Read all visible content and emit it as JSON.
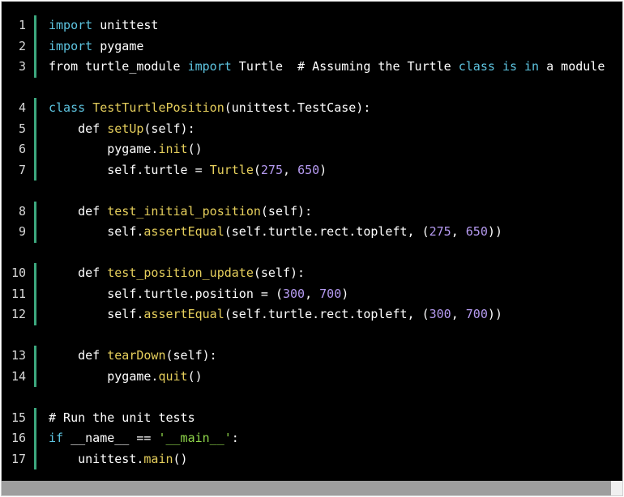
{
  "code": {
    "lines": [
      {
        "num": "1",
        "tokens": [
          {
            "t": "import",
            "c": "kw"
          },
          {
            "t": " unittest",
            "c": ""
          }
        ]
      },
      {
        "num": "2",
        "tokens": [
          {
            "t": "import",
            "c": "kw"
          },
          {
            "t": " pygame",
            "c": ""
          }
        ]
      },
      {
        "num": "3",
        "tokens": [
          {
            "t": "from turtle_module ",
            "c": ""
          },
          {
            "t": "import",
            "c": "kw"
          },
          {
            "t": " Turtle  # Assuming the Turtle ",
            "c": ""
          },
          {
            "t": "class",
            "c": "kw"
          },
          {
            "t": " ",
            "c": ""
          },
          {
            "t": "is",
            "c": "kw"
          },
          {
            "t": " ",
            "c": ""
          },
          {
            "t": "in",
            "c": "kw"
          },
          {
            "t": " a module",
            "c": ""
          }
        ]
      },
      {
        "num": "4",
        "tokens": [
          {
            "t": "class",
            "c": "kw"
          },
          {
            "t": " ",
            "c": ""
          },
          {
            "t": "TestTurtlePosition",
            "c": "fn"
          },
          {
            "t": "(unittest.TestCase):",
            "c": ""
          }
        ]
      },
      {
        "num": "5",
        "tokens": [
          {
            "t": "    def ",
            "c": ""
          },
          {
            "t": "setUp",
            "c": "fn"
          },
          {
            "t": "(self):",
            "c": ""
          }
        ]
      },
      {
        "num": "6",
        "tokens": [
          {
            "t": "        pygame.",
            "c": ""
          },
          {
            "t": "init",
            "c": "fn"
          },
          {
            "t": "()",
            "c": ""
          }
        ]
      },
      {
        "num": "7",
        "tokens": [
          {
            "t": "        self.turtle = ",
            "c": ""
          },
          {
            "t": "Turtle",
            "c": "fn"
          },
          {
            "t": "(",
            "c": ""
          },
          {
            "t": "275",
            "c": "num"
          },
          {
            "t": ", ",
            "c": ""
          },
          {
            "t": "650",
            "c": "num"
          },
          {
            "t": ")",
            "c": ""
          }
        ]
      },
      {
        "num": "8",
        "tokens": [
          {
            "t": "    def ",
            "c": ""
          },
          {
            "t": "test_initial_position",
            "c": "fn"
          },
          {
            "t": "(self):",
            "c": ""
          }
        ]
      },
      {
        "num": "9",
        "tokens": [
          {
            "t": "        self.",
            "c": ""
          },
          {
            "t": "assertEqual",
            "c": "fn"
          },
          {
            "t": "(self.turtle.rect.topleft, (",
            "c": ""
          },
          {
            "t": "275",
            "c": "num"
          },
          {
            "t": ", ",
            "c": ""
          },
          {
            "t": "650",
            "c": "num"
          },
          {
            "t": "))",
            "c": ""
          }
        ]
      },
      {
        "num": "10",
        "tokens": [
          {
            "t": "    def ",
            "c": ""
          },
          {
            "t": "test_position_update",
            "c": "fn"
          },
          {
            "t": "(self):",
            "c": ""
          }
        ]
      },
      {
        "num": "11",
        "tokens": [
          {
            "t": "        self.turtle.position = (",
            "c": ""
          },
          {
            "t": "300",
            "c": "num"
          },
          {
            "t": ", ",
            "c": ""
          },
          {
            "t": "700",
            "c": "num"
          },
          {
            "t": ")",
            "c": ""
          }
        ]
      },
      {
        "num": "12",
        "tokens": [
          {
            "t": "        self.",
            "c": ""
          },
          {
            "t": "assertEqual",
            "c": "fn"
          },
          {
            "t": "(self.turtle.rect.topleft, (",
            "c": ""
          },
          {
            "t": "300",
            "c": "num"
          },
          {
            "t": ", ",
            "c": ""
          },
          {
            "t": "700",
            "c": "num"
          },
          {
            "t": "))",
            "c": ""
          }
        ]
      },
      {
        "num": "13",
        "tokens": [
          {
            "t": "    def ",
            "c": ""
          },
          {
            "t": "tearDown",
            "c": "fn"
          },
          {
            "t": "(self):",
            "c": ""
          }
        ]
      },
      {
        "num": "14",
        "tokens": [
          {
            "t": "        pygame.",
            "c": ""
          },
          {
            "t": "quit",
            "c": "fn"
          },
          {
            "t": "()",
            "c": ""
          }
        ]
      },
      {
        "num": "15",
        "tokens": [
          {
            "t": "# Run the unit tests",
            "c": "cm"
          }
        ]
      },
      {
        "num": "16",
        "tokens": [
          {
            "t": "if",
            "c": "kw"
          },
          {
            "t": " __name__ == ",
            "c": ""
          },
          {
            "t": "'__main__'",
            "c": "str"
          },
          {
            "t": ":",
            "c": ""
          }
        ]
      },
      {
        "num": "17",
        "tokens": [
          {
            "t": "    unittest.",
            "c": ""
          },
          {
            "t": "main",
            "c": "fn"
          },
          {
            "t": "()",
            "c": ""
          }
        ]
      }
    ]
  },
  "colors": {
    "background": "#000000",
    "keyword": "#5dc4e0",
    "function": "#e6cf5c",
    "number": "#b59af0",
    "string": "#8fd64a",
    "gutter_bar": "#3ca87e"
  }
}
